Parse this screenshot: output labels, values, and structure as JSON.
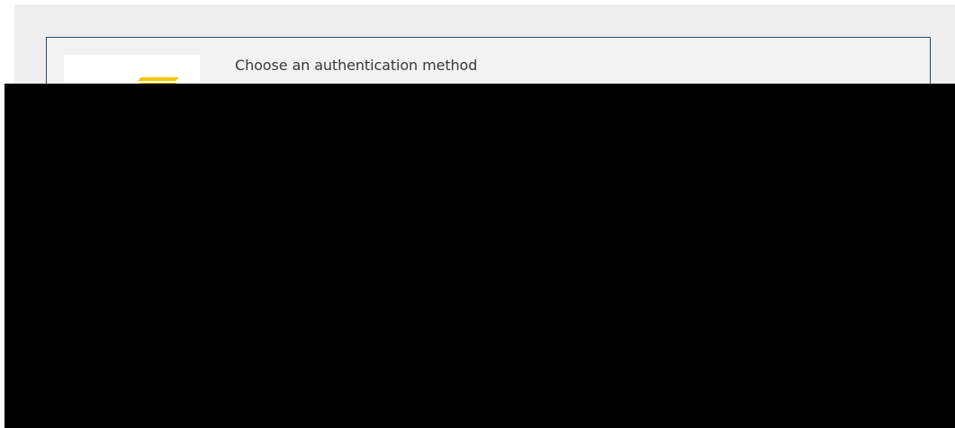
{
  "auth_panel": {
    "title": "Choose an authentication method"
  },
  "logo": {
    "icon": "brand-logo-icon",
    "color": "#f5c400"
  },
  "colors": {
    "background": "#efefef",
    "card_border": "#2c4a66",
    "redaction": "#000000"
  }
}
